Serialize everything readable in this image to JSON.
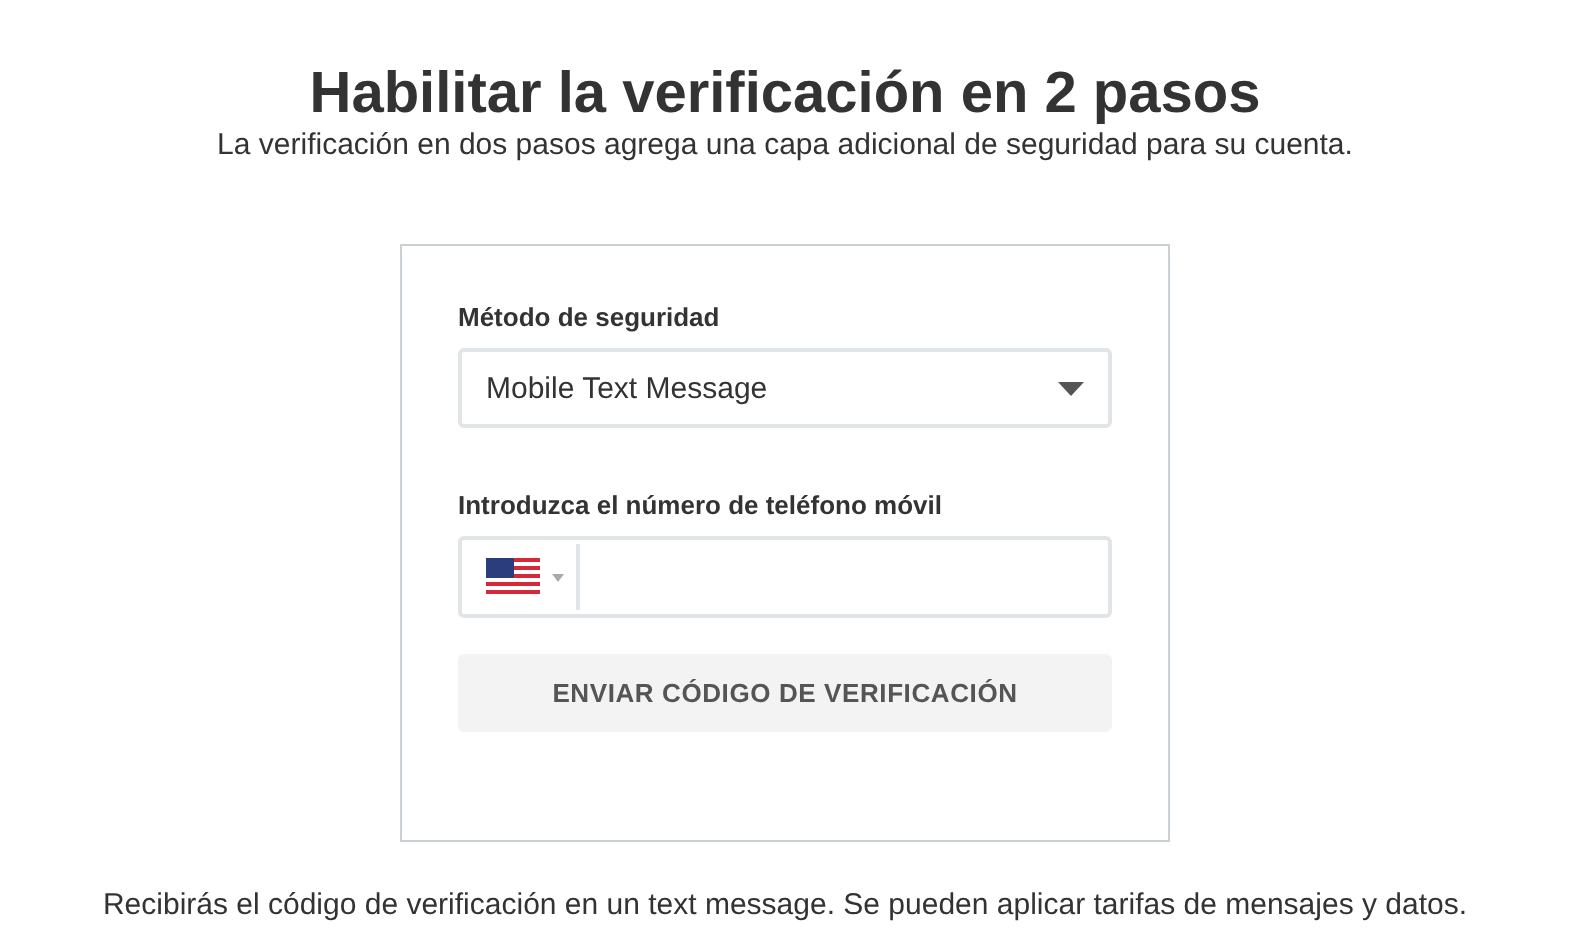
{
  "title": "Habilitar la verificación en 2 pasos",
  "subtitle": "La verificación en dos pasos agrega una capa adicional de seguridad para su cuenta.",
  "form": {
    "method_label": "Método de seguridad",
    "method_value": "Mobile Text Message",
    "phone_label": "Introduzca el número de teléfono móvil",
    "button": "ENVIAR CÓDIGO DE VERIFICACIÓN"
  },
  "footer_note": "Recibirás el código de verificación en un text message. Se pueden aplicar tarifas de mensajes y datos."
}
